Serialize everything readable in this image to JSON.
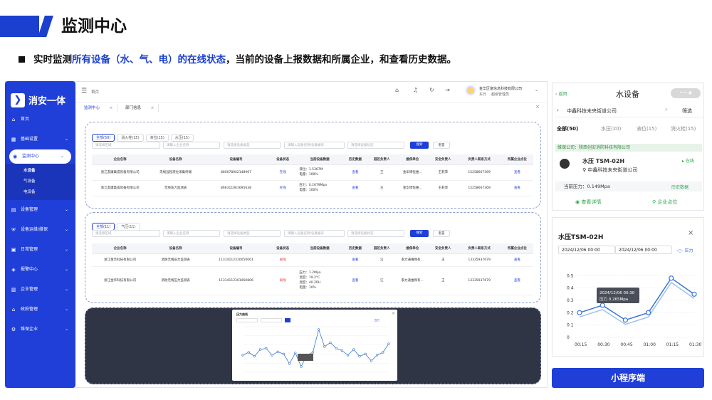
{
  "header": {
    "title": "监测中心"
  },
  "sub": {
    "p1": "实时监测",
    "hl": "所有设备（水、气、电）的在线状态",
    "p2": "，当前的设备上报数据和所属企业，和查看历史数据。"
  },
  "sidebar": {
    "logo": "消安一体",
    "items": [
      {
        "label": "首页",
        "icon": "home-icon"
      },
      {
        "label": "基础设置",
        "icon": "grid-icon"
      },
      {
        "label": "监测中心",
        "icon": "monitor-icon"
      },
      {
        "label": "设备管理",
        "icon": "device-icon"
      },
      {
        "label": "设备运维/维保",
        "icon": "shield-icon"
      },
      {
        "label": "日常管理",
        "icon": "calendar-icon"
      },
      {
        "label": "报警中心",
        "icon": "alarm-icon"
      },
      {
        "label": "企业管理",
        "icon": "building-icon"
      },
      {
        "label": "政府管理",
        "icon": "government-icon"
      },
      {
        "label": "维保企业",
        "icon": "wrench-icon"
      }
    ],
    "sub": [
      "水设备",
      "气设备",
      "电设备"
    ]
  },
  "topbar": {
    "breadcrumb": "首页",
    "company": "金华区富信息科技有限公司",
    "user": "东日",
    "role": "超级管理员"
  },
  "tabs": [
    "监测中心",
    "部门信息"
  ],
  "water": {
    "filters": [
      "全部(50)",
      "消火栓(15)",
      "液位(15)",
      "水压(15)"
    ],
    "inputs": [
      "请选择区域",
      "请输入企业名称",
      "请选择设备类型",
      "请输入设备名称/设备编号",
      "请选择设备状态"
    ],
    "query": "搜索",
    "reset": "重置",
    "columns": [
      "企业名称",
      "设备名称",
      "设备编号",
      "设备状态",
      "当前设备数据",
      "历史数据",
      "园区负责人",
      "维保单位",
      "安全负责人",
      "负责人联系方式",
      "所属企业点位"
    ],
    "rows": [
      [
        "浙江友康集成装备有限公司",
        "无线远程液位采集终端",
        "860078002148967",
        "在线",
        "液位：1.5367M|电量：100%",
        "查看",
        "王",
        "金华博恒维...",
        "王莉萍",
        "15258667369",
        "查看"
      ],
      [
        "浙江友康集成装备有限公司",
        "无线压力监测表",
        "866311061695638",
        "在线",
        "压力：0.1679Mpa|电量：100%",
        "查看",
        "王",
        "金华博恒维...",
        "王莉萍",
        "15258667369",
        "查看"
      ]
    ]
  },
  "gas": {
    "filters": [
      "全部(11)",
      "气压(11)"
    ],
    "inputs": [
      "请选择区域",
      "请输入企业名称",
      "请选择设备类型",
      "请输入设备名称/设备编号",
      "请选择设备状态"
    ],
    "query": "搜索",
    "reset": "重置",
    "columns": [
      "企业名称",
      "设备名称",
      "设备编号",
      "设备状态",
      "当前设备数据",
      "历史数据",
      "园区负责人",
      "维保单位",
      "安全负责人",
      "负责人联系方式",
      "所属企业点位"
    ],
    "rows": [
      [
        "浙江金华科技有限公司",
        "消防无线压力监测表",
        "11314112310050061",
        "离线",
        "",
        "查看",
        "汪",
        "家力通维保有...",
        "王",
        "13335937679",
        "查看"
      ],
      [
        "浙江金华科技有限公司",
        "消防无线压力监测表",
        "11314112301060806",
        "离线",
        "压力：1.2Mpa|温度：19.2°C|湿度：40.2RH|电量：10%",
        "查看",
        "汪",
        "家力通维保有...",
        "王",
        "13335937679",
        "查看"
      ]
    ]
  },
  "mini_chart": {
    "title": "压力曲线",
    "legend": "压力",
    "chart_data": {
      "type": "line",
      "values": [
        0.3,
        0.35,
        0.28,
        0.4,
        0.42,
        0.3,
        0.36,
        0.32,
        0.15,
        0.34,
        0.1,
        0.3,
        0.35,
        0.75,
        0.45,
        0.52,
        0.42,
        0.38,
        0.3,
        0.4,
        0.28,
        0.32,
        0.2,
        0.3,
        0.35,
        0.5
      ]
    }
  },
  "mobile": {
    "back": "返回",
    "title": "水设备",
    "search": "中鑫科技未央街道公司",
    "filter": "筛选",
    "tabs": [
      "全部(50)",
      "水压(20)",
      "液位(15)",
      "消火栓(15)"
    ],
    "maint": "维保公司：陕西创安消防科技有限公司",
    "device": "水压 TSM-02H",
    "company": "中鑫科技未央街道公司",
    "status": "在线",
    "pressure": "当前压力：0.149Mpa",
    "history": "历史数据",
    "detail": "查看详情",
    "location": "企业点位"
  },
  "chart_card": {
    "title": "水压TSM-02H",
    "start": "2024/12/06 00:00",
    "end": "2024/12/06 00:00",
    "legend": "压力",
    "tooltip_time": "2024/12/06  00:30",
    "tooltip_val": "压力 0.265Mpa",
    "chart_data": {
      "type": "line",
      "x": [
        "00:15",
        "00:30",
        "00:45",
        "01:00",
        "01:15",
        "01:30"
      ],
      "values": [
        0.2,
        0.26,
        0.14,
        0.2,
        0.48,
        0.35
      ],
      "ylim": [
        0,
        0.6
      ],
      "yticks": [
        "0",
        "0.1",
        "0.2",
        "0.3",
        "0.4",
        "0.5"
      ]
    }
  },
  "mini_program": "小程序端"
}
